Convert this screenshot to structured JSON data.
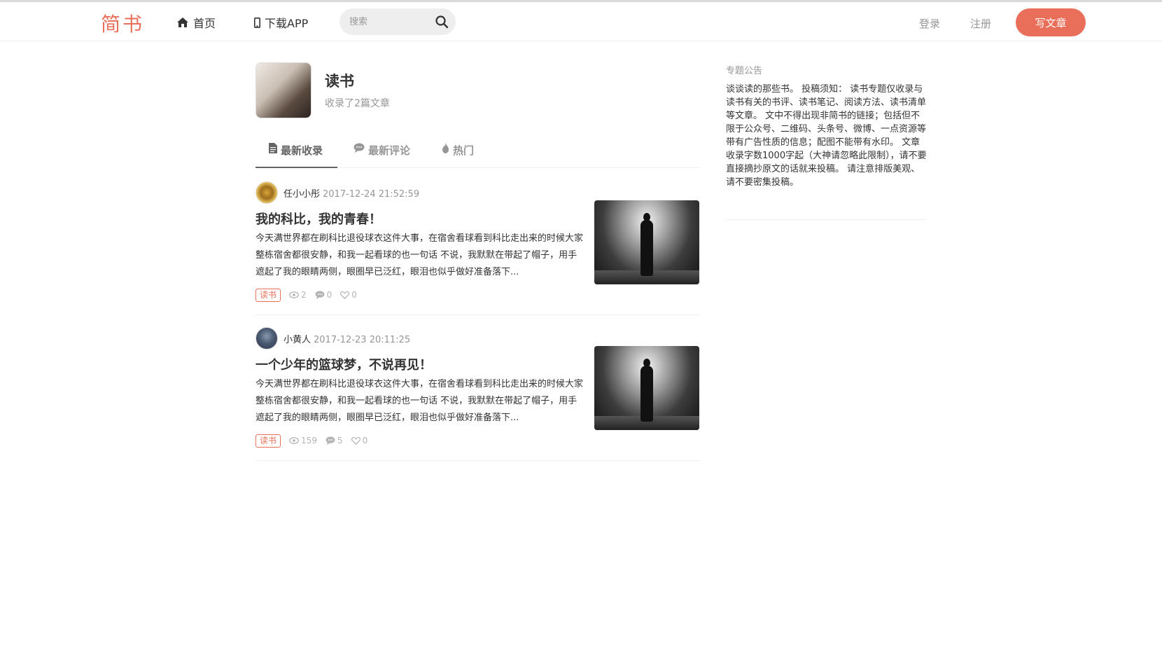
{
  "navbar": {
    "logo": "简书",
    "home_label": "首页",
    "app_label": "下载APP",
    "search_placeholder": "搜索",
    "login_label": "登录",
    "register_label": "注册",
    "write_label": "写文章"
  },
  "collection": {
    "title": "读书",
    "info": "收录了2篇文章"
  },
  "tabs": [
    {
      "label": "最新收录",
      "active": true
    },
    {
      "label": "最新评论",
      "active": false
    },
    {
      "label": "热门",
      "active": false
    }
  ],
  "articles": [
    {
      "author": "任小小彤",
      "time": "2017-12-24 21:52:59",
      "title": "我的科比，我的青春！",
      "abstract": "今天满世界都在刷科比退役球衣这件大事，在宿舍看球看到科比走出来的时候大家整栋宿舍都很安静，和我一起看球的也一句话 不说，我默默在带起了帽子，用手遮起了我的眼睛两侧，眼圈早已泛红，眼泪也似乎做好准备落下...",
      "tag": "读书",
      "views": "2",
      "comments": "0",
      "likes": "0"
    },
    {
      "author": "小黄人",
      "time": "2017-12-23 20:11:25",
      "title": "一个少年的篮球梦，不说再见！",
      "abstract": "今天满世界都在刷科比退役球衣这件大事，在宿舍看球看到科比走出来的时候大家整栋宿舍都很安静，和我一起看球的也一句话 不说，我默默在带起了帽子，用手遮起了我的眼睛两侧，眼圈早已泛红，眼泪也似乎做好准备落下...",
      "tag": "读书",
      "views": "159",
      "comments": "5",
      "likes": "0"
    }
  ],
  "sidebar": {
    "notice_title": "专题公告",
    "notice_body": "谈谈读的那些书。 投稿须知： 读书专题仅收录与读书有关的书评、读书笔记、阅读方法、读书清单等文章。 文中不得出现非简书的链接；包括但不限于公众号、二维码、头条号、微博、一点资源等带有广告性质的信息；配图不能带有水印。 文章收录字数1000字起（大神请忽略此限制），请不要直接摘抄原文的话就来投稿。 请注意排版美观、请不要密集投稿。"
  },
  "colors": {
    "accent": "#ea6f5a",
    "muted": "#969696",
    "text": "#333333"
  },
  "icons": [
    "home-icon",
    "phone-icon",
    "search-icon",
    "document-icon",
    "comment-icon",
    "fire-icon",
    "eye-icon",
    "comment-icon",
    "heart-icon"
  ]
}
